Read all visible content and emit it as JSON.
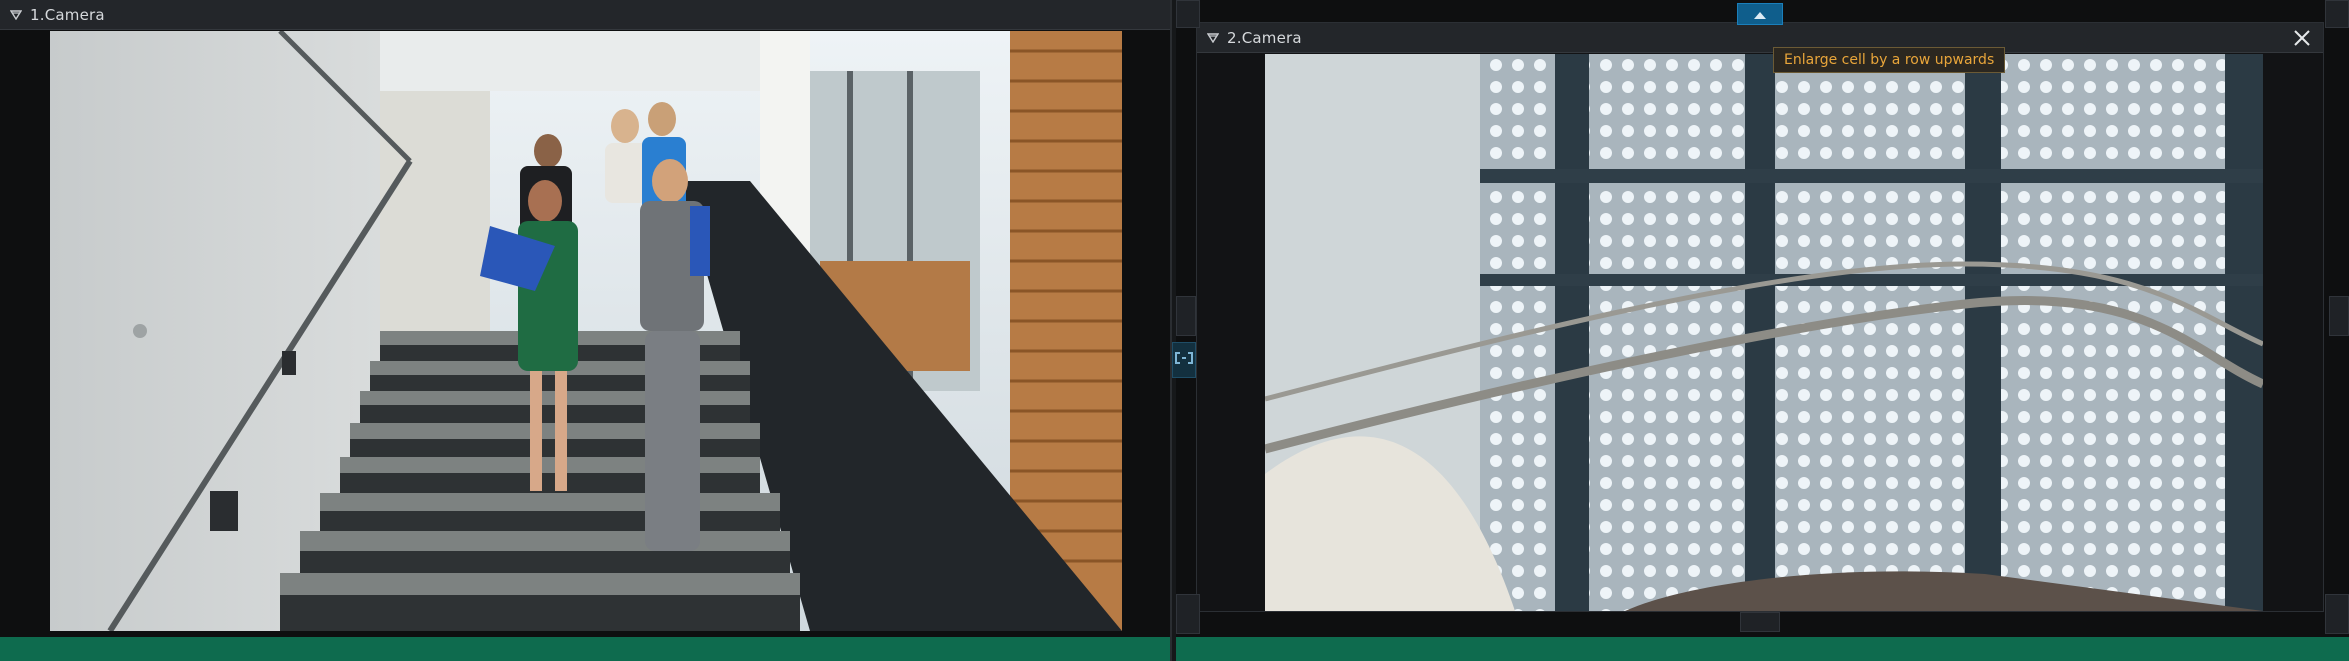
{
  "cameras": [
    {
      "title": "1.Camera"
    },
    {
      "title": "2.Camera"
    }
  ],
  "tooltip": {
    "text": "Enlarge cell by a row upwards"
  },
  "icons": {
    "collapse": "triangle-down-icon",
    "close": "close-icon",
    "enlarge_up": "arrow-up-icon",
    "swap": "swap-cells-icon"
  },
  "colors": {
    "status_bar": "#0e6b4e",
    "accent": "#0f5e8c",
    "tooltip_text": "#e8a53a"
  }
}
